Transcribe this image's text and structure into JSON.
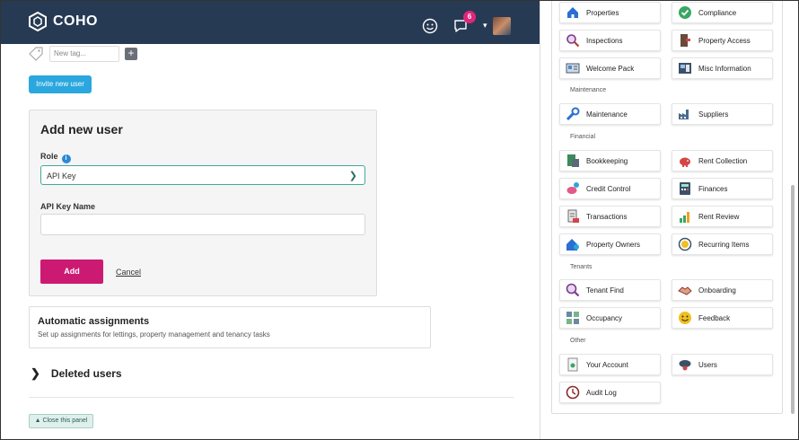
{
  "header": {
    "brand": "COHO",
    "notification_count": "6"
  },
  "tags": {
    "placeholder": "New tag..."
  },
  "buttons": {
    "invite": "Invite new user",
    "add": "Add",
    "cancel": "Cancel",
    "close_panel": "Close this panel"
  },
  "add_user": {
    "title": "Add new user",
    "role_label": "Role",
    "role_value": "API Key",
    "api_key_label": "API Key Name",
    "api_key_value": ""
  },
  "auto_assign": {
    "title": "Automatic assignments",
    "subtitle": "Set up assignments for lettings, property management and tenancy tasks"
  },
  "deleted": {
    "label": "Deleted users"
  },
  "menu": {
    "top": [
      {
        "label": "Properties",
        "icon": "house-icon"
      },
      {
        "label": "Compliance",
        "icon": "check-circle-icon"
      },
      {
        "label": "Inspections",
        "icon": "magnifier-icon"
      },
      {
        "label": "Property Access",
        "icon": "door-key-icon"
      },
      {
        "label": "Welcome Pack",
        "icon": "brochure-icon"
      },
      {
        "label": "Misc Information",
        "icon": "info-doc-icon"
      }
    ],
    "maintenance_title": "Maintenance",
    "maintenance": [
      {
        "label": "Maintenance",
        "icon": "wrench-icon"
      },
      {
        "label": "Suppliers",
        "icon": "factory-icon"
      }
    ],
    "financial_title": "Financial",
    "financial": [
      {
        "label": "Bookkeeping",
        "icon": "ledger-icon"
      },
      {
        "label": "Rent Collection",
        "icon": "piggy-bank-icon"
      },
      {
        "label": "Credit Control",
        "icon": "piggy-coin-icon"
      },
      {
        "label": "Finances",
        "icon": "calculator-icon"
      },
      {
        "label": "Transactions",
        "icon": "receipt-icon"
      },
      {
        "label": "Rent Review",
        "icon": "bar-growth-icon"
      },
      {
        "label": "Property Owners",
        "icon": "owner-house-icon"
      },
      {
        "label": "Recurring Items",
        "icon": "recurring-coin-icon"
      }
    ],
    "tenants_title": "Tenants",
    "tenants": [
      {
        "label": "Tenant Find",
        "icon": "search-person-icon"
      },
      {
        "label": "Onboarding",
        "icon": "handshake-icon"
      },
      {
        "label": "Occupancy",
        "icon": "grid-rooms-icon"
      },
      {
        "label": "Feedback",
        "icon": "smiley-icon"
      }
    ],
    "other_title": "Other",
    "other": [
      {
        "label": "Your Account",
        "icon": "account-doc-icon"
      },
      {
        "label": "Users",
        "icon": "users-cloud-icon"
      },
      {
        "label": "Audit Log",
        "icon": "clock-icon"
      }
    ]
  },
  "colors": {
    "header_bg": "#273a54",
    "accent_blue": "#2aa7de",
    "primary_pink": "#cc1a73",
    "teal_border": "#45a89a",
    "badge": "#e0267a"
  }
}
